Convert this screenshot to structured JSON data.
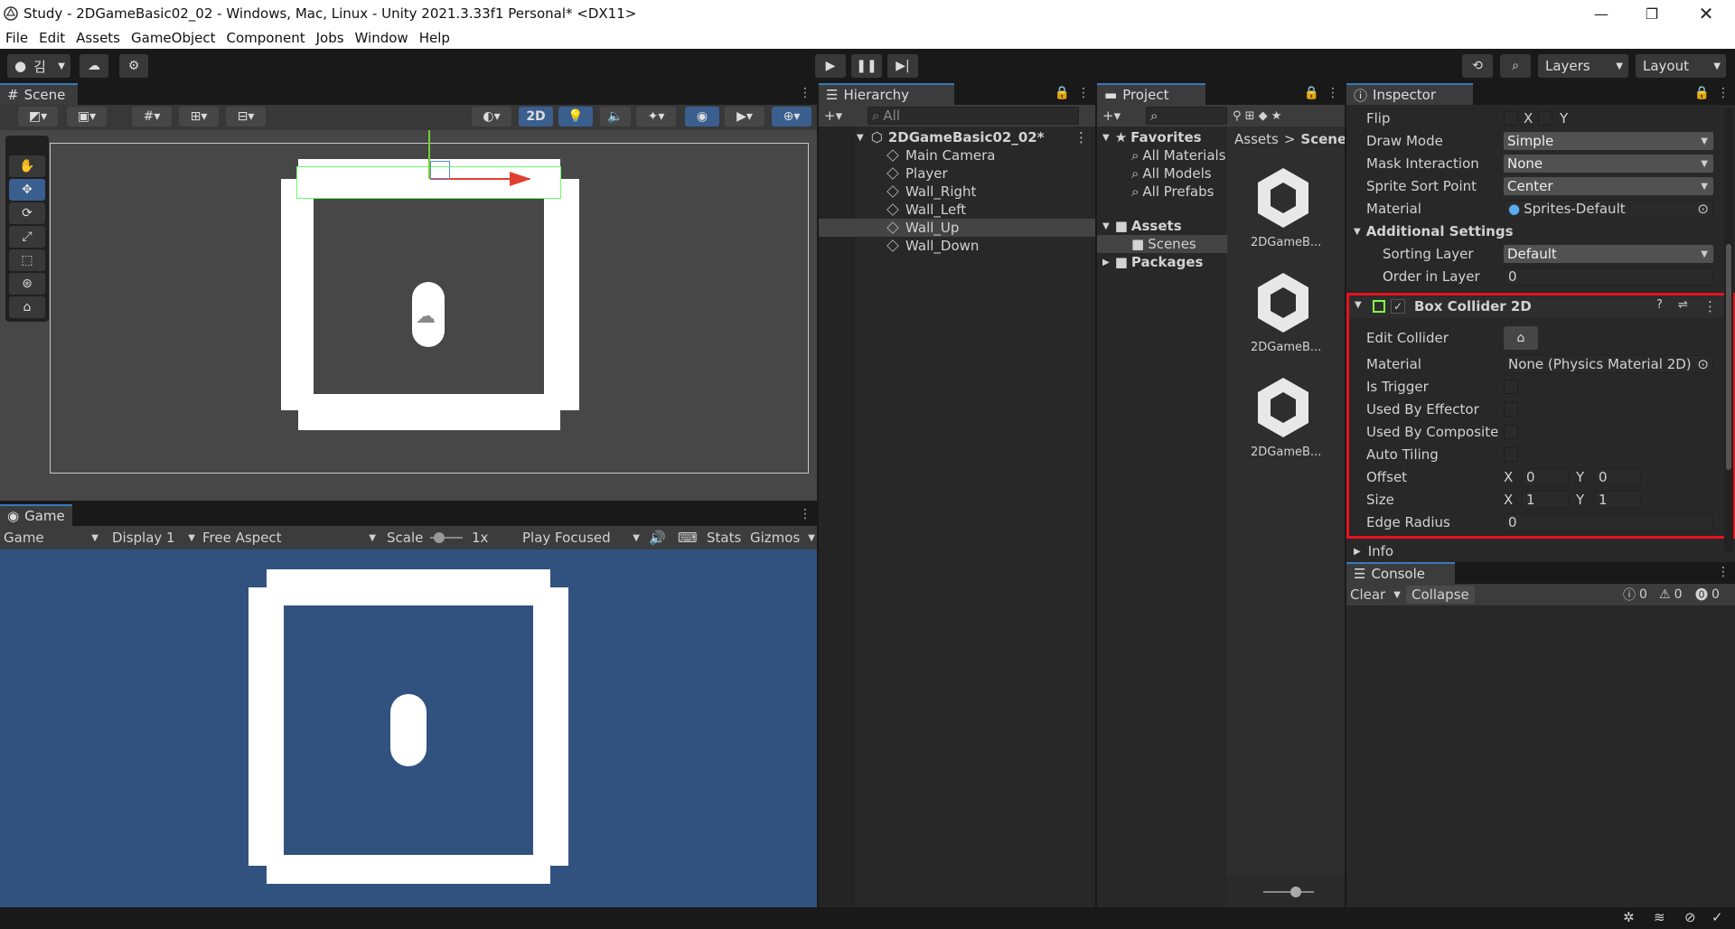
{
  "window": {
    "title": "Study - 2DGameBasic02_02 - Windows, Mac, Linux - Unity 2021.3.33f1 Personal* <DX11>"
  },
  "menu": [
    "File",
    "Edit",
    "Assets",
    "GameObject",
    "Component",
    "Jobs",
    "Window",
    "Help"
  ],
  "toolbar": {
    "account": "김",
    "layers": "Layers",
    "layout": "Layout"
  },
  "scene": {
    "tab": "Scene",
    "mode_2d": "2D"
  },
  "game": {
    "tab": "Game",
    "view": "Game",
    "display": "Display 1",
    "aspect": "Free Aspect",
    "scale_label": "Scale",
    "scale_value": "1x",
    "play_mode": "Play Focused",
    "stats": "Stats",
    "gizmos": "Gizmos"
  },
  "hierarchy": {
    "tab": "Hierarchy",
    "search_placeholder": "All",
    "root": "2DGameBasic02_02*",
    "items": [
      "Main Camera",
      "Player",
      "Wall_Right",
      "Wall_Left",
      "Wall_Up",
      "Wall_Down"
    ],
    "selected": "Wall_Up"
  },
  "project": {
    "tab": "Project",
    "favorites": "Favorites",
    "fav_items": [
      "All Materials",
      "All Models",
      "All Prefabs"
    ],
    "assets": "Assets",
    "scenes": "Scenes",
    "packages": "Packages",
    "breadcrumb": [
      "Assets",
      "Scenes"
    ],
    "files": [
      "2DGameB...",
      "2DGameB...",
      "2DGameB..."
    ]
  },
  "inspector": {
    "tab": "Inspector",
    "sprite": [
      {
        "label": "Flip",
        "x": "X",
        "y": "Y"
      },
      {
        "label": "Draw Mode",
        "value": "Simple"
      },
      {
        "label": "Mask Interaction",
        "value": "None"
      },
      {
        "label": "Sprite Sort Point",
        "value": "Center"
      },
      {
        "label": "Material",
        "value": "Sprites-Default"
      }
    ],
    "additional": "Additional Settings",
    "sorting_layer_label": "Sorting Layer",
    "sorting_layer": "Default",
    "order_label": "Order in Layer",
    "order": "0",
    "collider": {
      "title": "Box Collider 2D",
      "edit": "Edit Collider",
      "material_label": "Material",
      "material": "None (Physics Material 2D)",
      "is_trigger": "Is Trigger",
      "used_by_effector": "Used By Effector",
      "used_by_composite": "Used By Composite",
      "auto_tiling": "Auto Tiling",
      "offset_label": "Offset",
      "offset_x": "0",
      "offset_y": "0",
      "size_label": "Size",
      "size_x": "1",
      "size_y": "1",
      "edge_label": "Edge Radius",
      "edge": "0",
      "x": "X",
      "y": "Y"
    },
    "info": "Info"
  },
  "console": {
    "tab": "Console",
    "clear": "Clear",
    "collapse": "Collapse",
    "logs": "0",
    "warnings": "0",
    "errors": "0"
  },
  "colors": {
    "highlight": "#e8121f",
    "game_bg": "#31527f",
    "accent": "#3a79bb"
  }
}
